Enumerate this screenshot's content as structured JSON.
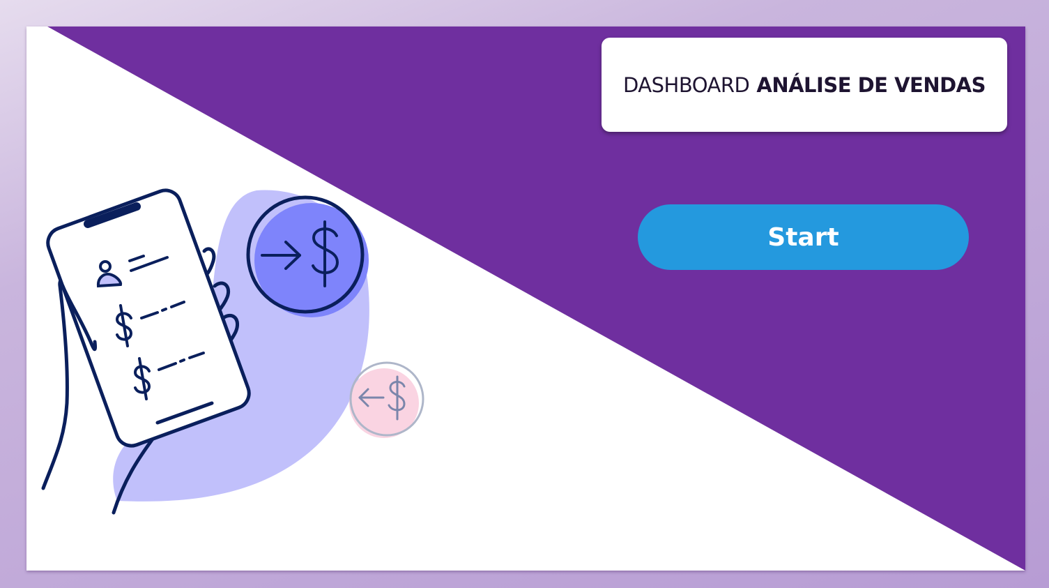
{
  "title": {
    "prefix": "DASHBOARD",
    "main": "ANÁLISE DE VENDAS"
  },
  "start_button": {
    "label": "Start"
  },
  "colors": {
    "purple": "#6f2f9f",
    "button_blue": "#2499de",
    "blob_lavender": "#c1c0fb",
    "coin_blue": "#7e84fb",
    "coin_pink": "#fad4e2",
    "ink_navy": "#0a1f5c"
  },
  "illustration": {
    "icons": [
      "hand-holding-phone-icon",
      "incoming-dollar-coin-icon",
      "outgoing-dollar-coin-icon"
    ]
  }
}
